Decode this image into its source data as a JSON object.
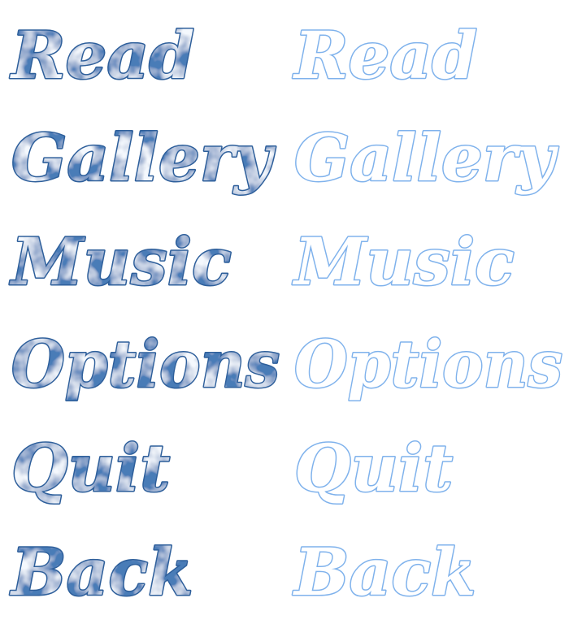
{
  "menu": {
    "items": [
      {
        "label": "Read"
      },
      {
        "label": "Gallery"
      },
      {
        "label": "Music"
      },
      {
        "label": "Options"
      },
      {
        "label": "Quit"
      },
      {
        "label": "Back"
      }
    ]
  },
  "states": {
    "hover": {
      "outline_color": "#2e5f9b",
      "fill": "cloud-texture",
      "cloud_light": "#ffffff",
      "cloud_dark": "#4f7fba"
    },
    "idle": {
      "outline_color": "#7fb2ec",
      "fill": "#ffffff"
    }
  }
}
